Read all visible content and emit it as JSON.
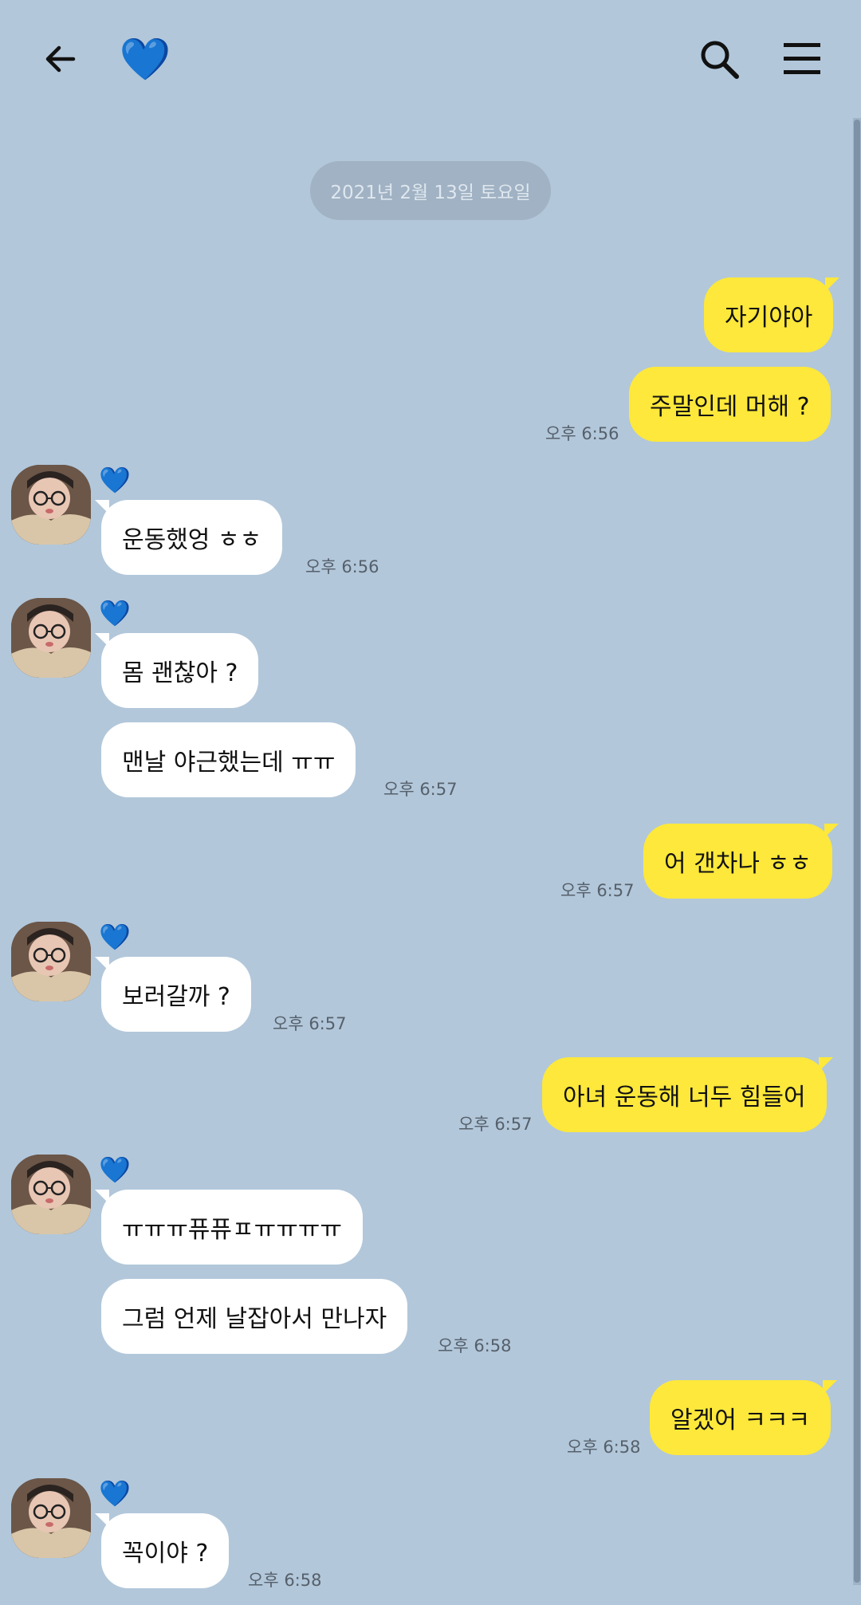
{
  "header": {
    "back_icon": "arrow-left-icon",
    "chat_title_icon": "blue-heart-icon",
    "chat_title_glyph": "💙",
    "search_icon": "search-icon",
    "menu_icon": "hamburger-menu-icon"
  },
  "colors": {
    "background": "#b2c7da",
    "my_bubble": "#fde83b",
    "their_bubble": "#ffffff",
    "heart": "#1e9bff"
  },
  "date_divider": "2021년 2월 13일 토요일",
  "sender": {
    "name_glyph": "💙"
  },
  "messages": [
    {
      "from": "me",
      "text": "자기야아",
      "time": ""
    },
    {
      "from": "me",
      "text": "주말인데 머해 ?",
      "time": "오후 6:56"
    },
    {
      "from": "them",
      "text": "운동했엉 ㅎㅎ",
      "time": "오후 6:56"
    },
    {
      "from": "them",
      "text": "몸 괜찮아 ?",
      "time": ""
    },
    {
      "from": "them",
      "text": "맨날 야근했는데 ㅠㅠ",
      "time": "오후 6:57"
    },
    {
      "from": "me",
      "text": "어 갠차나 ㅎㅎ",
      "time": "오후 6:57"
    },
    {
      "from": "them",
      "text": "보러갈까 ?",
      "time": "오후 6:57"
    },
    {
      "from": "me",
      "text": "아녀 운동해 너두 힘들어",
      "time": "오후 6:57"
    },
    {
      "from": "them",
      "text": "ㅠㅠㅠ퓨퓨ㅍㅠㅠㅠㅠ",
      "time": ""
    },
    {
      "from": "them",
      "text": "그럼 언제 날잡아서 만나자",
      "time": "오후 6:58"
    },
    {
      "from": "me",
      "text": "알겠어 ㅋㅋㅋ",
      "time": "오후 6:58"
    },
    {
      "from": "them",
      "text": "꼭이야 ?",
      "time": "오후 6:58"
    }
  ]
}
